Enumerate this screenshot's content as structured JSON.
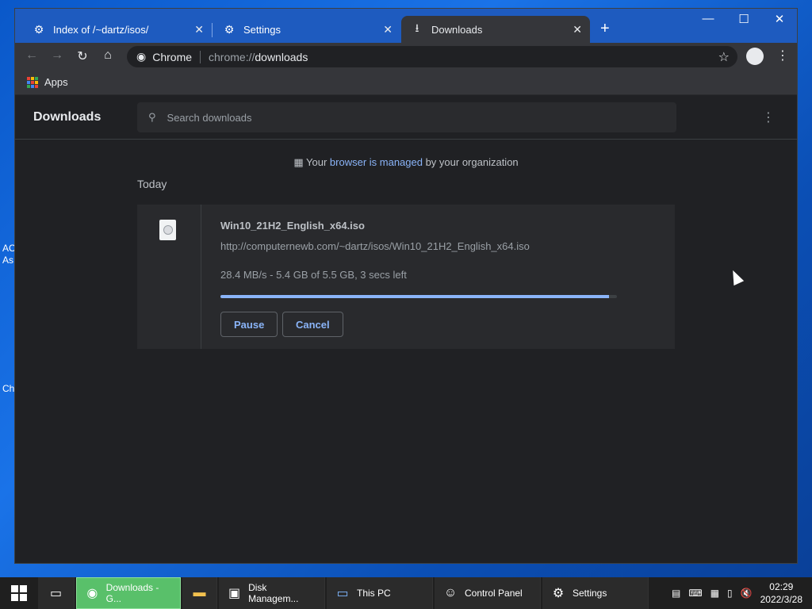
{
  "desktop": {
    "labels": [
      "AC",
      "As",
      "Ch"
    ]
  },
  "browser": {
    "tabs": [
      {
        "title": "Index of /~dartz/isos/",
        "icon": "site-icon",
        "active": false
      },
      {
        "title": "Settings",
        "icon": "gear-icon",
        "active": false
      },
      {
        "title": "Downloads",
        "icon": "download-icon",
        "active": true
      }
    ],
    "omnibox": {
      "chip_label": "Chrome",
      "scheme": "chrome://",
      "path": "downloads"
    },
    "bookmarks": {
      "apps_label": "Apps"
    }
  },
  "downloads": {
    "title": "Downloads",
    "search_placeholder": "Search downloads",
    "managed_notice": {
      "prefix": "Your ",
      "link": "browser is managed",
      "suffix": " by your organization"
    },
    "section_date": "Today",
    "item": {
      "filename": "Win10_21H2_English_x64.iso",
      "url": "http://computernewb.com/~dartz/isos/Win10_21H2_English_x64.iso",
      "status": "28.4 MB/s - 5.4 GB of 5.5 GB, 3 secs left",
      "progress_percent": 98,
      "pause_label": "Pause",
      "cancel_label": "Cancel"
    }
  },
  "taskbar": {
    "items": [
      {
        "label": "Downloads - G...",
        "icon": "chrome-icon",
        "active": true
      },
      {
        "label": "",
        "icon": "file-explorer-icon",
        "active": false
      },
      {
        "label": "Disk Managem...",
        "icon": "disk-management-icon",
        "active": false
      },
      {
        "label": "This PC",
        "icon": "this-pc-icon",
        "active": false
      },
      {
        "label": "Control Panel",
        "icon": "control-panel-icon",
        "active": false
      },
      {
        "label": "Settings",
        "icon": "settings-gear-icon",
        "active": false
      }
    ],
    "clock": {
      "time": "02:29",
      "date": "2022/3/28"
    }
  },
  "colors": {
    "accent": "#8ab4f8",
    "page_bg": "#202124",
    "taskbar_active": "#59c06a"
  }
}
